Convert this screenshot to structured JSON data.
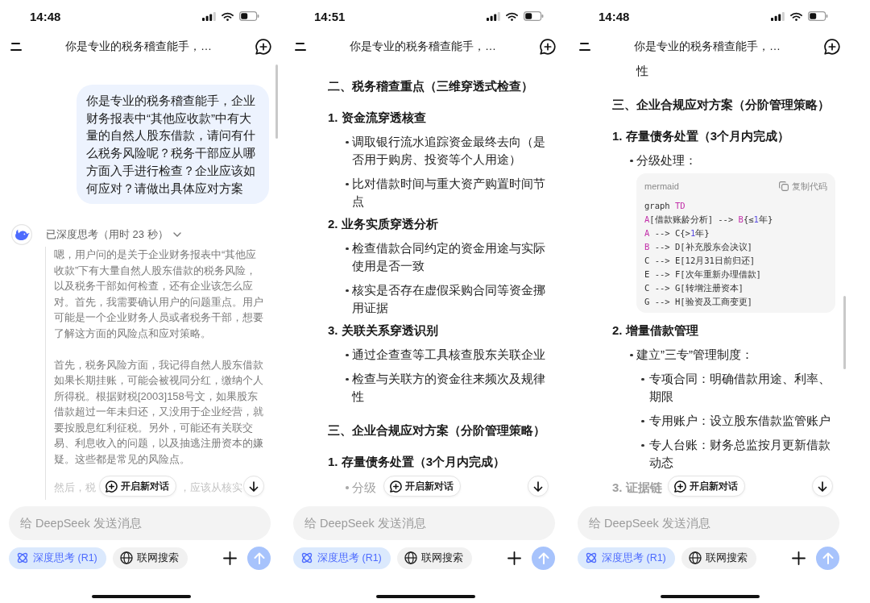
{
  "phones": [
    {
      "status_bar": {
        "time": "14:48"
      },
      "header": {
        "title": "你是专业的税务稽查能手，…"
      },
      "scroll_bar": {
        "kind": "top"
      },
      "messages": [
        {
          "kind": "user_message",
          "text": "你是专业的税务稽查能手，企业财务报表中“其他应收款”中有大量的自然人股东借款，请问有什么税务风险呢？税务干部应从哪方面入手进行检查？企业应该如何应对？请做出具体应对方案"
        },
        {
          "kind": "thinking",
          "title": "已深度思考（用时 23 秒）",
          "paragraphs": [
            "嗯，用户问的是关于企业财务报表中“其他应收款”下有大量自然人股东借款的税务风险，以及税务干部如何检查，还有企业该怎么应对。首先，我需要确认用户的问题重点。用户可能是一个企业财务人员或者税务干部，想要了解这方面的风险点和应对策略。",
            "首先，税务风险方面，我记得自然人股东借款如果长期挂账，可能会被视同分红，缴纳个人所得税。根据财税[2003]158号文，如果股东借款超过一年未归还，又没用于企业经营，就要按股息红利征税。另外，可能还有关联交易、利息收入的问题，以及抽逃注册资本的嫌疑。这些都是常见的风险点。"
          ]
        }
      ],
      "cut_line": {
        "kind": "thinking",
        "segments": [
          "然后，税",
          "，应该从核实"
        ]
      },
      "floating": {
        "new_chat": "开启新对话"
      },
      "composer": {
        "placeholder": "给 DeepSeek 发送消息",
        "toggles": [
          {
            "label": "深度思考 (R1)",
            "selected": true
          },
          {
            "label": "联网搜索",
            "selected": false
          }
        ],
        "send_enabled": false
      }
    },
    {
      "status_bar": {
        "time": "14:51"
      },
      "header": {
        "title": "你是专业的税务稽查能手，…"
      },
      "messages": [
        {
          "kind": "heading",
          "text": "二、税务稽查重点（三维穿透式检查）"
        },
        {
          "kind": "numbered",
          "text": "1. 资金流穿透核查"
        },
        {
          "kind": "bullet",
          "text": "调取银行流水追踪资金最终去向（是否用于购房、投资等个人用途）"
        },
        {
          "kind": "bullet",
          "text": "比对借款时间与重大资产购置时间节点"
        },
        {
          "kind": "numbered",
          "text": "2. 业务实质穿透分析"
        },
        {
          "kind": "bullet",
          "text": "检查借款合同约定的资金用途与实际使用是否一致"
        },
        {
          "kind": "bullet",
          "text": "核实是否存在虚假采购合同等资金挪用证据"
        },
        {
          "kind": "numbered",
          "text": "3. 关联关系穿透识别"
        },
        {
          "kind": "bullet",
          "text": "通过企查查等工具核查股东关联企业"
        },
        {
          "kind": "bullet",
          "text": "检查与关联方的资金往来频次及规律性"
        },
        {
          "kind": "heading",
          "text": "三、企业合规应对方案（分阶管理策略）"
        },
        {
          "kind": "numbered",
          "text": "1. 存量债务处置（3个月内完成）"
        }
      ],
      "cut_line": {
        "kind": "bullet",
        "segments": [
          "分级"
        ]
      },
      "floating": {
        "new_chat": "开启新对话"
      },
      "composer": {
        "placeholder": "给 DeepSeek 发送消息",
        "toggles": [
          {
            "label": "深度思考 (R1)",
            "selected": true
          },
          {
            "label": "联网搜索",
            "selected": false
          }
        ],
        "send_enabled": false
      }
    },
    {
      "status_bar": {
        "time": "14:48"
      },
      "header": {
        "title": "你是专业的税务稽查能手，…"
      },
      "scroll_bar": {
        "kind": "middle"
      },
      "messages": [
        {
          "kind": "continuation",
          "text": "性"
        },
        {
          "kind": "heading",
          "text": "三、企业合规应对方案（分阶管理策略）"
        },
        {
          "kind": "numbered",
          "text": "1. 存量债务处置（3个月内完成）"
        },
        {
          "kind": "bullet",
          "text": "分级处理："
        },
        {
          "kind": "code",
          "language": "mermaid",
          "copy_label": "复制代码",
          "lines": [
            [
              {
                "text": "graph ",
                "kind": "plain"
              },
              {
                "text": "TD",
                "kind": "keyword"
              }
            ],
            [
              {
                "text": "A",
                "kind": "keyword"
              },
              {
                "text": "[借款账龄分析] --> ",
                "kind": "plain"
              },
              {
                "text": "B",
                "kind": "keyword"
              },
              {
                "text": "{≤",
                "kind": "plain"
              },
              {
                "text": "1",
                "kind": "number"
              },
              {
                "text": "年}",
                "kind": "plain"
              }
            ],
            [
              {
                "text": "A",
                "kind": "keyword"
              },
              {
                "text": " --> C{>",
                "kind": "plain"
              },
              {
                "text": "1",
                "kind": "number"
              },
              {
                "text": "年}",
                "kind": "plain"
              }
            ],
            [
              {
                "text": "B",
                "kind": "keyword"
              },
              {
                "text": " --> D[补充股东会决议]",
                "kind": "plain"
              }
            ],
            [
              {
                "text": "C --> E[12月31日前归还]",
                "kind": "plain"
              }
            ],
            [
              {
                "text": "E --> F[次年重新办理借款]",
                "kind": "plain"
              }
            ],
            [
              {
                "text": "C --> G[转增注册资本]",
                "kind": "plain"
              }
            ],
            [
              {
                "text": "G --> H[验资及工商变更]",
                "kind": "plain"
              }
            ]
          ]
        },
        {
          "kind": "numbered",
          "text": "2. 增量借款管理"
        },
        {
          "kind": "bullet",
          "text": "建立”三专”管理制度：",
          "children": [
            {
              "kind": "bullet",
              "text": "专项合同：明确借款用途、利率、期限"
            },
            {
              "kind": "bullet",
              "text": "专用账户：设立股东借款监管账户"
            },
            {
              "kind": "bullet",
              "text": "专人台账：财务总监按月更新借款动态"
            }
          ]
        }
      ],
      "cut_line": {
        "kind": "numbered",
        "segments": [
          "3. 证据链"
        ]
      },
      "floating": {
        "new_chat": "开启新对话"
      },
      "composer": {
        "placeholder": "给 DeepSeek 发送消息",
        "toggles": [
          {
            "label": "深度思考 (R1)",
            "selected": true
          },
          {
            "label": "联网搜索",
            "selected": false
          }
        ],
        "send_enabled": false
      }
    }
  ]
}
